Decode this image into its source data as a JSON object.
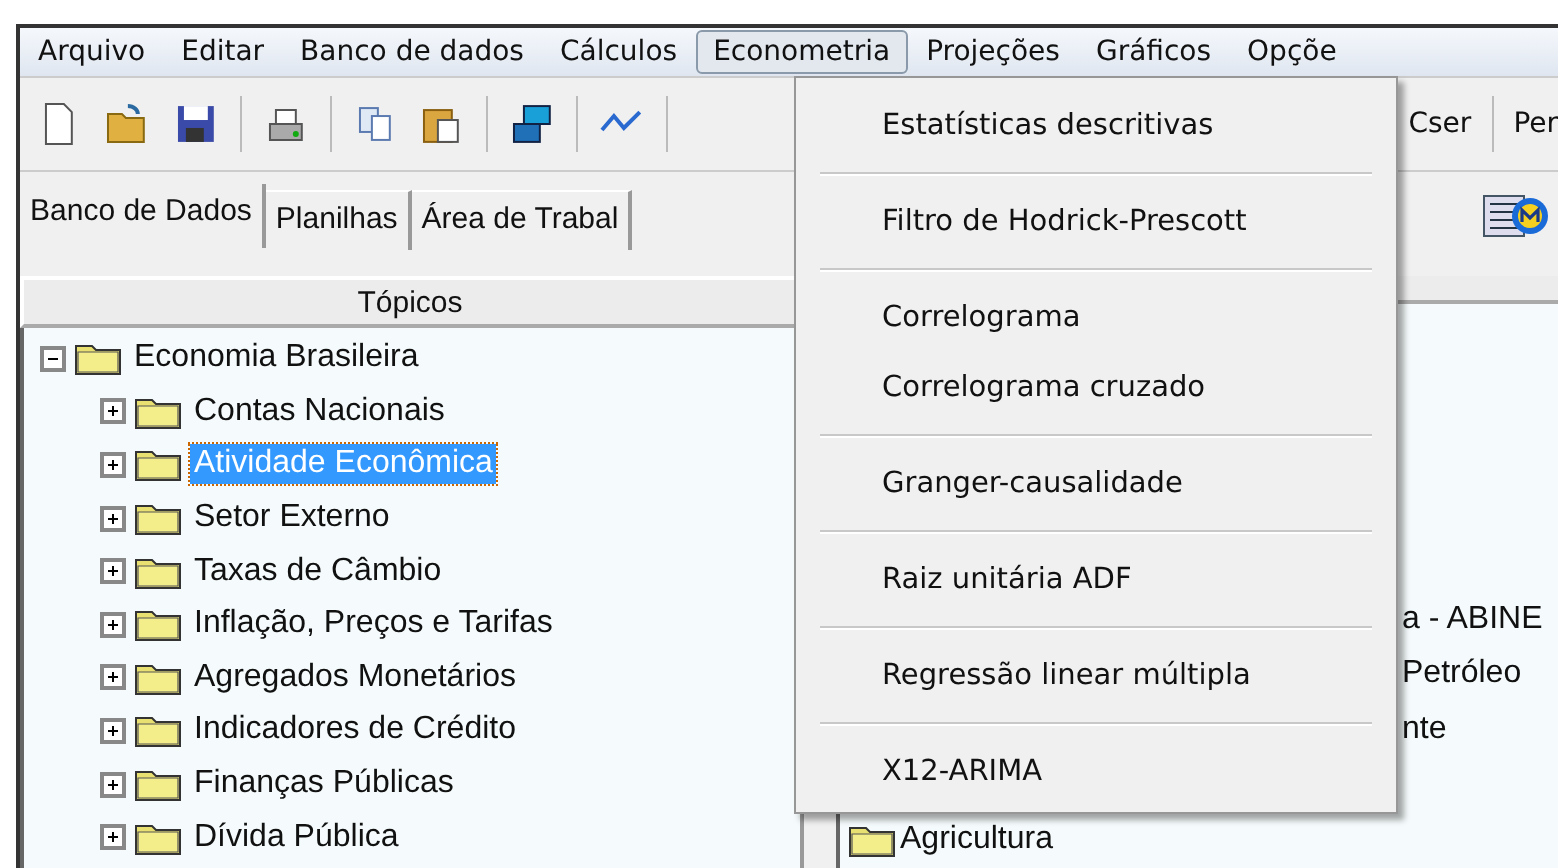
{
  "menu_bar": [
    {
      "label": "Arquivo",
      "selected": false
    },
    {
      "label": "Editar",
      "selected": false
    },
    {
      "label": "Banco de dados",
      "selected": false
    },
    {
      "label": "Cálculos",
      "selected": false
    },
    {
      "label": "Econometria",
      "selected": true
    },
    {
      "label": "Projeções",
      "selected": false
    },
    {
      "label": "Gráficos",
      "selected": false
    },
    {
      "label": "Opçõe",
      "selected": false
    }
  ],
  "toolbar": {
    "text_buttons": [
      "Cser",
      "Per"
    ]
  },
  "tabs": [
    {
      "label": "Banco de Dados",
      "selected": true
    },
    {
      "label": "Planilhas",
      "selected": false
    },
    {
      "label": "Área de Trabal",
      "selected": false
    }
  ],
  "left_panel": {
    "header": "Tópicos",
    "tree": [
      {
        "label": "Economia Brasileira",
        "expanded": true,
        "selected": false,
        "children": [
          {
            "label": "Contas Nacionais",
            "expanded": false,
            "selected": false
          },
          {
            "label": "Atividade Econômica",
            "expanded": false,
            "selected": true
          },
          {
            "label": "Setor Externo",
            "expanded": false,
            "selected": false
          },
          {
            "label": "Taxas de Câmbio",
            "expanded": false,
            "selected": false
          },
          {
            "label": "Inflação, Preços e Tarifas",
            "expanded": false,
            "selected": false
          },
          {
            "label": "Agregados Monetários",
            "expanded": false,
            "selected": false
          },
          {
            "label": "Indicadores de Crédito",
            "expanded": false,
            "selected": false
          },
          {
            "label": "Finanças Públicas",
            "expanded": false,
            "selected": false
          },
          {
            "label": "Dívida Pública",
            "expanded": false,
            "selected": false
          }
        ]
      }
    ]
  },
  "right_panel": {
    "items": [
      {
        "kind": "blank"
      },
      {
        "kind": "blank"
      },
      {
        "kind": "blank"
      },
      {
        "kind": "blank"
      },
      {
        "kind": "blank"
      },
      {
        "kind": "partial",
        "label": "a - ABINE"
      },
      {
        "kind": "partial",
        "label": "Petróleo"
      },
      {
        "kind": "partial",
        "label": "nte"
      },
      {
        "kind": "blank"
      },
      {
        "kind": "folder",
        "label": "Agricultura"
      }
    ]
  },
  "dropdown_menu": [
    {
      "kind": "item",
      "label": "Estatísticas descritivas"
    },
    {
      "kind": "separator"
    },
    {
      "kind": "item",
      "label": "Filtro de Hodrick-Prescott"
    },
    {
      "kind": "separator"
    },
    {
      "kind": "item",
      "label": "Correlograma"
    },
    {
      "kind": "item",
      "label": "Correlograma cruzado"
    },
    {
      "kind": "separator"
    },
    {
      "kind": "item",
      "label": "Granger-causalidade"
    },
    {
      "kind": "separator"
    },
    {
      "kind": "item",
      "label": "Raiz unitária ADF"
    },
    {
      "kind": "separator"
    },
    {
      "kind": "item",
      "label": "Regressão linear múltipla"
    },
    {
      "kind": "separator"
    },
    {
      "kind": "item",
      "label": "X12-ARIMA"
    }
  ]
}
